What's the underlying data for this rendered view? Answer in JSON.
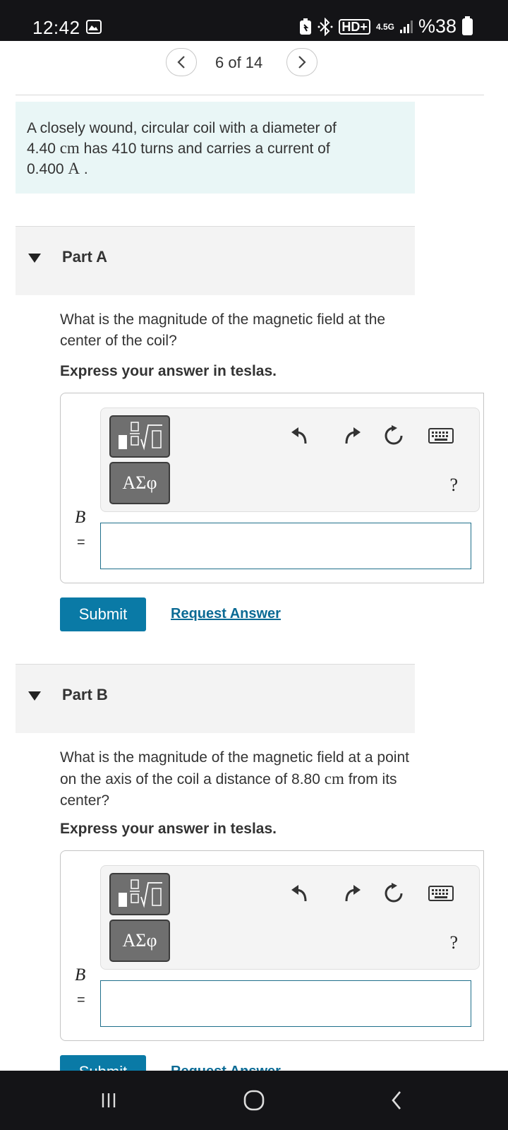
{
  "status_bar": {
    "time": "12:42",
    "network": "4.5G",
    "battery": "%38",
    "hd_label": "HD+"
  },
  "pager": {
    "prev": "<",
    "position": "6 of 14",
    "next": ">"
  },
  "problem": {
    "line1": "A closely wound, circular coil with a diameter of",
    "diameter_value": "4.40",
    "diameter_unit": "cm",
    "line2_rest": "has 410 turns and carries a current of",
    "current_value": "0.400",
    "current_unit": "A"
  },
  "part_a": {
    "label": "Part A",
    "question": "What is the magnitude of the magnetic field at the center of the coil?",
    "express": "Express your answer in teslas.",
    "variable": "B",
    "equals": "=",
    "input_value": "",
    "greek": "ΑΣφ",
    "help": "?",
    "submit": "Submit",
    "request": "Request Answer"
  },
  "part_b": {
    "label": "Part B",
    "question_pre": "What is the magnitude of the magnetic field at a point on the axis of the coil a distance of",
    "distance_value": "8.80",
    "distance_unit": "cm",
    "question_post": "from its center?",
    "express": "Express your answer in teslas.",
    "variable": "B",
    "equals": "=",
    "input_value": "",
    "greek": "ΑΣφ",
    "help": "?",
    "submit": "Submit",
    "request": "Request Answer"
  },
  "icons": [
    "gallery-icon",
    "battery-saver-icon",
    "bluetooth-icon",
    "signal-icon",
    "battery-icon",
    "templates-icon",
    "undo-icon",
    "redo-icon",
    "reset-icon",
    "keyboard-icon",
    "recents-icon",
    "home-icon",
    "back-icon"
  ]
}
